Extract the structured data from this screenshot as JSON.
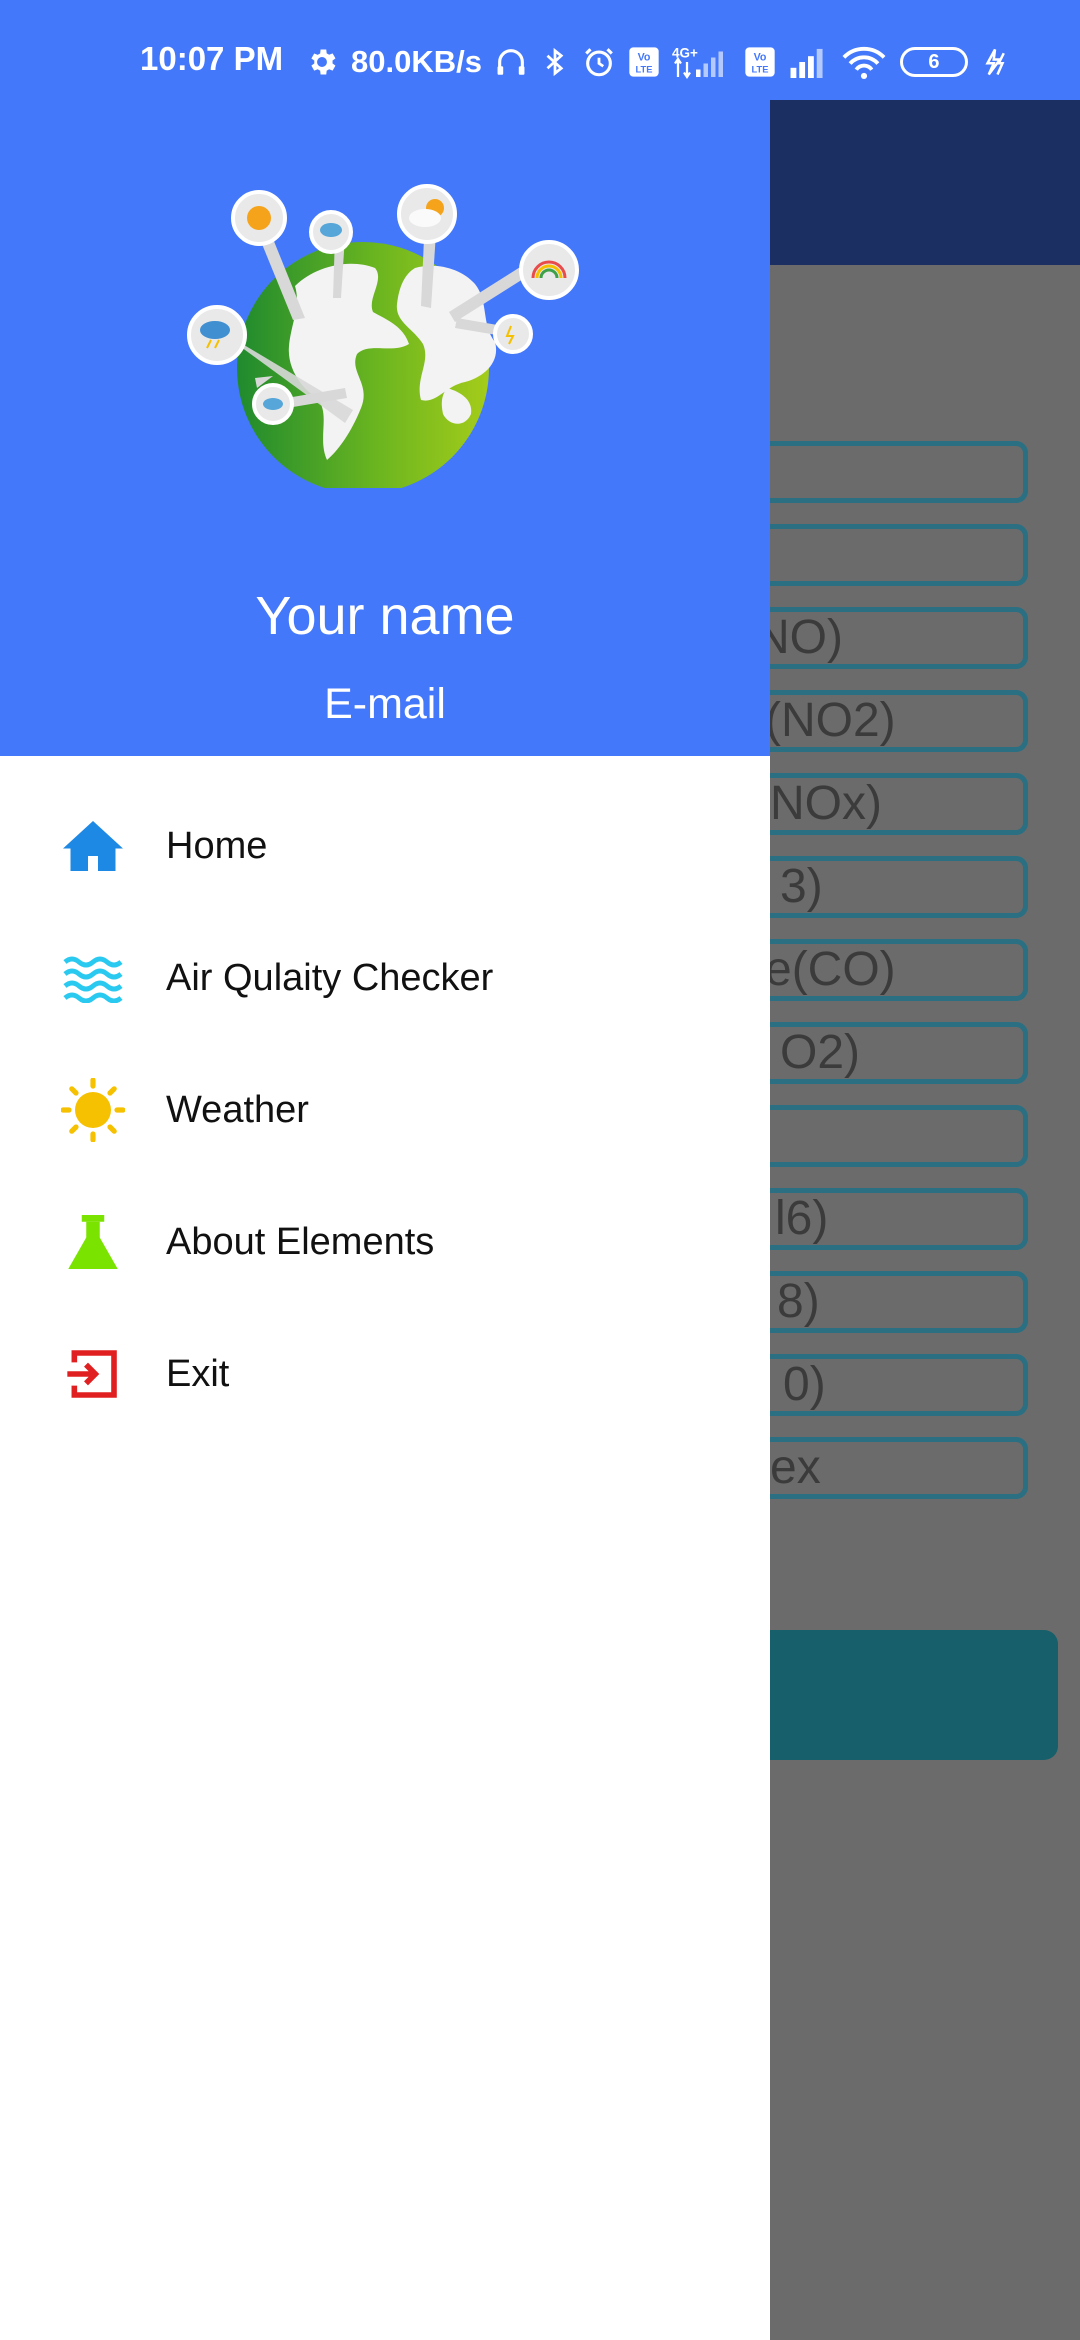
{
  "status_bar": {
    "time": "10:07 PM",
    "network_speed": "80.0KB/s",
    "battery_level": "6",
    "icons": [
      "gear-icon",
      "headphones-icon",
      "bluetooth-icon",
      "alarm-icon",
      "volte-icon",
      "signal-4g-icon",
      "volte-icon",
      "signal-icon",
      "wifi-icon",
      "battery-icon",
      "charging-icon"
    ]
  },
  "drawer": {
    "header": {
      "user_name": "Your name",
      "user_email": "E-mail",
      "logo_icon": "weather-globe-icon",
      "color": "#4478fb"
    },
    "menu": [
      {
        "label": "Home",
        "icon": "home-icon",
        "color": "#1e88e5"
      },
      {
        "label": "Air Qulaity Checker",
        "icon": "air-waves-icon",
        "color": "#29c9f0"
      },
      {
        "label": "Weather",
        "icon": "sun-icon",
        "color": "#f6c100"
      },
      {
        "label": "About Elements",
        "icon": "flask-icon",
        "color": "#7be300"
      },
      {
        "label": "Exit",
        "icon": "exit-icon",
        "color": "#e02020"
      }
    ]
  },
  "background_app": {
    "toolbar_color": "#1b2f63",
    "fields": [
      "",
      "",
      "NO)",
      "(NO2)",
      "NOx)",
      "3)",
      "e(CO)",
      "O2)",
      "",
      "l6)",
      "8)",
      "0)",
      "ex"
    ]
  }
}
